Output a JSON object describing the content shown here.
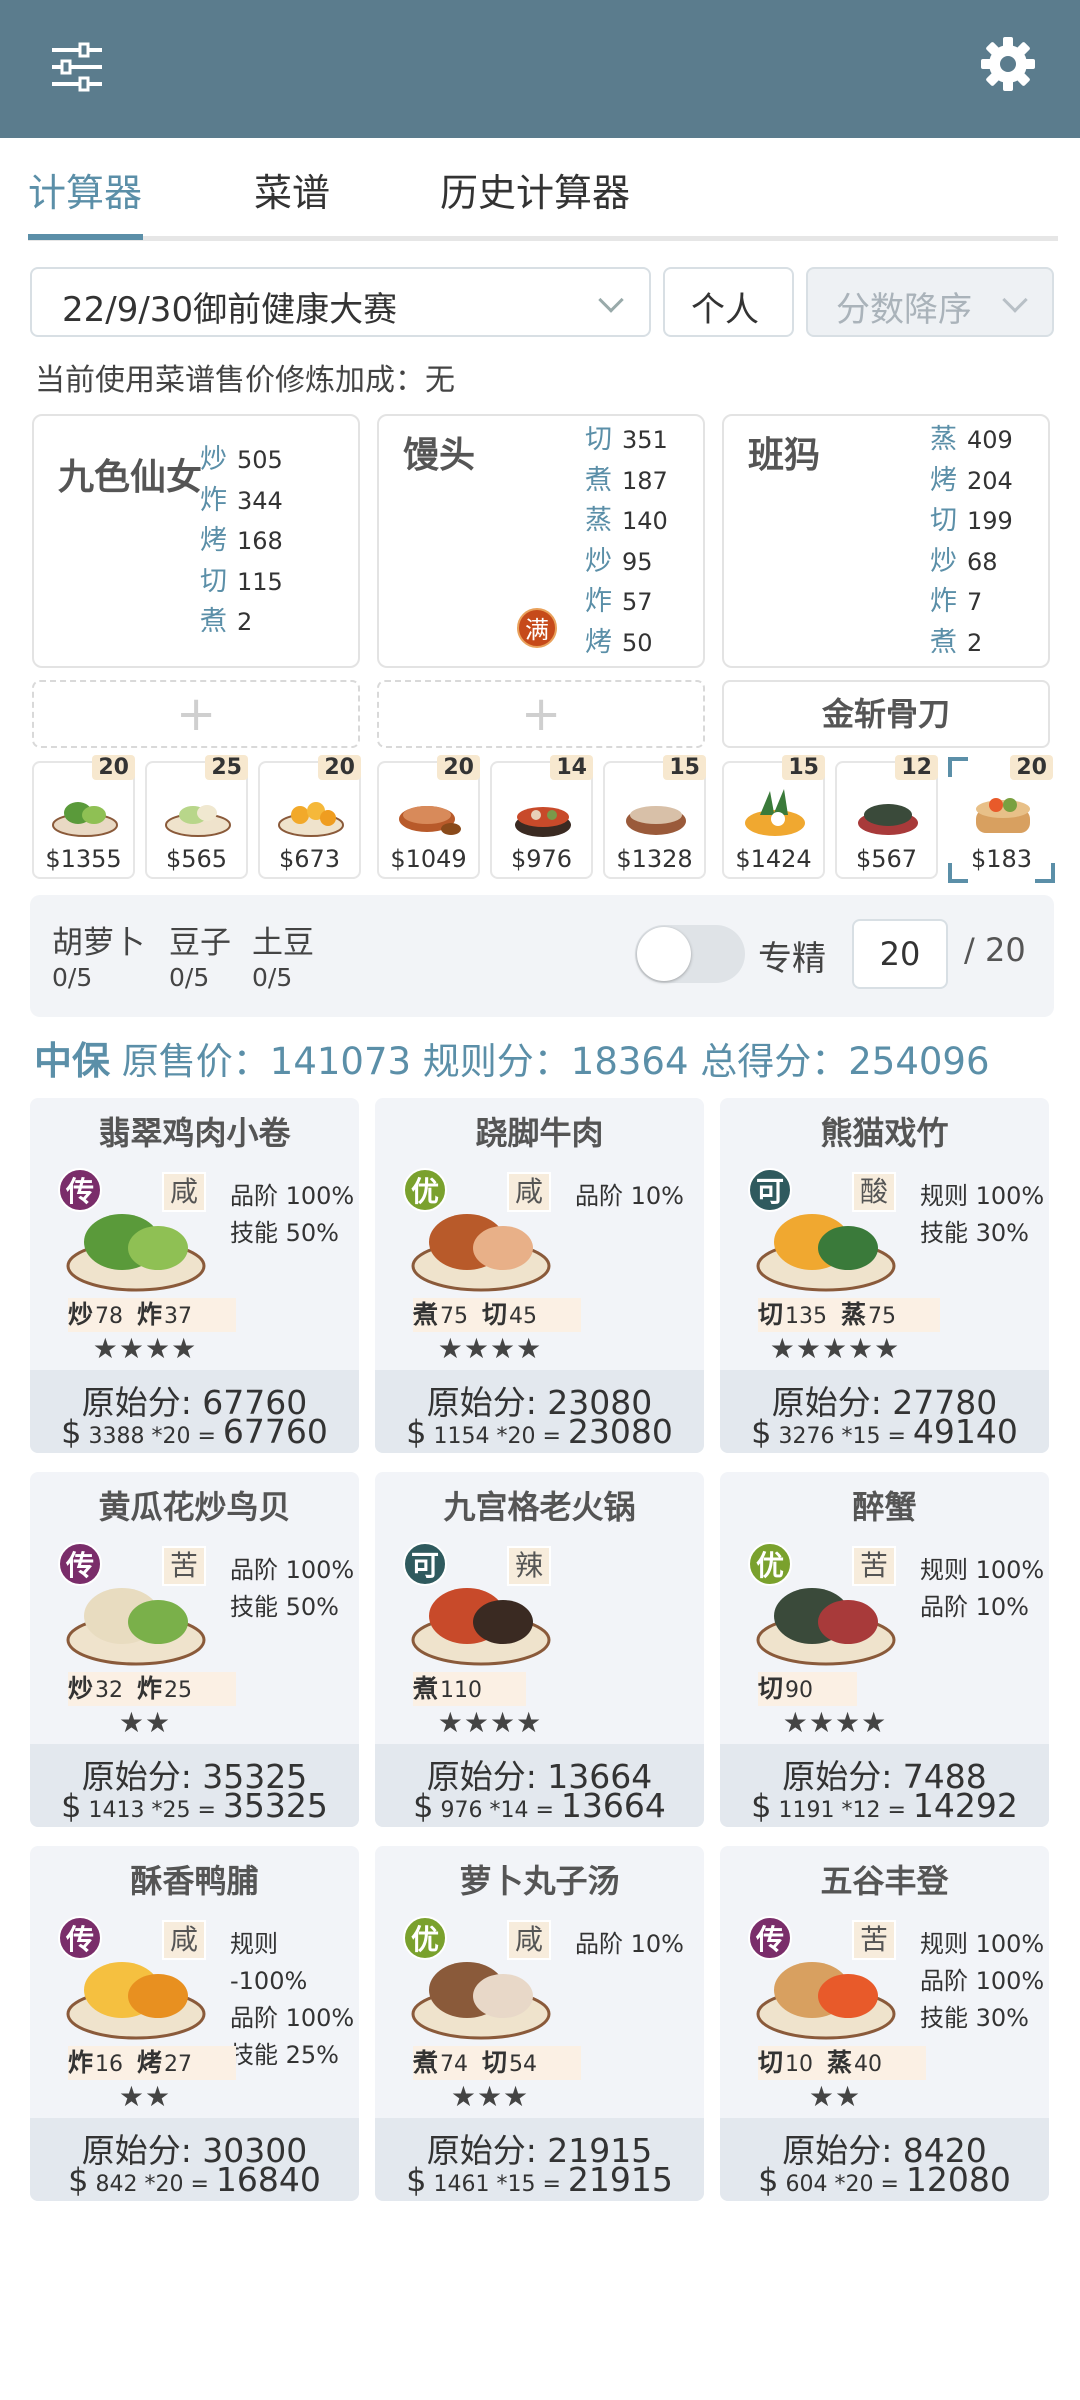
{
  "header": {
    "filter_icon": "sliders-icon",
    "settings_icon": "gear-icon"
  },
  "tabs": [
    {
      "label": "计算器"
    },
    {
      "label": "菜谱"
    },
    {
      "label": "历史计算器"
    }
  ],
  "controls": {
    "contest": "22/9/30御前健康大赛",
    "mode": "个人",
    "sort": "分数降序"
  },
  "note": "当前使用菜谱售价修炼加成：无",
  "chefs": [
    {
      "name": "九色仙女",
      "skills": [
        {
          "k": "炒",
          "v": "505"
        },
        {
          "k": "炸",
          "v": "344"
        },
        {
          "k": "烤",
          "v": "168"
        },
        {
          "k": "切",
          "v": "115"
        },
        {
          "k": "煮",
          "v": "2"
        }
      ]
    },
    {
      "name": "馒头",
      "badge": "满",
      "skills": [
        {
          "k": "切",
          "v": "351"
        },
        {
          "k": "煮",
          "v": "187"
        },
        {
          "k": "蒸",
          "v": "140"
        },
        {
          "k": "炒",
          "v": "95"
        },
        {
          "k": "炸",
          "v": "57"
        },
        {
          "k": "烤",
          "v": "50"
        }
      ]
    },
    {
      "name": "班犸",
      "skills": [
        {
          "k": "蒸",
          "v": "409"
        },
        {
          "k": "烤",
          "v": "204"
        },
        {
          "k": "切",
          "v": "199"
        },
        {
          "k": "炒",
          "v": "68"
        },
        {
          "k": "炸",
          "v": "7"
        },
        {
          "k": "煮",
          "v": "2"
        }
      ]
    }
  ],
  "equip": "金斩骨刀",
  "dishes": [
    {
      "count": "20",
      "price": "$1355"
    },
    {
      "count": "25",
      "price": "$565"
    },
    {
      "count": "20",
      "price": "$673"
    },
    {
      "count": "20",
      "price": "$1049"
    },
    {
      "count": "14",
      "price": "$976"
    },
    {
      "count": "15",
      "price": "$1328"
    },
    {
      "count": "15",
      "price": "$1424"
    },
    {
      "count": "12",
      "price": "$567"
    },
    {
      "count": "20",
      "price": "$183"
    }
  ],
  "ingredients": [
    {
      "name": "胡萝卜",
      "count": "0/5"
    },
    {
      "name": "豆子",
      "count": "0/5"
    },
    {
      "name": "土豆",
      "count": "0/5"
    }
  ],
  "specialize": {
    "label": "专精",
    "value": "20",
    "max": "/ 20",
    "on": false
  },
  "summary": {
    "grade": "中保",
    "text": "原售价：141073 规则分：18364 总得分：254096"
  },
  "recipes": [
    {
      "name": "翡翠鸡肉小卷",
      "grade": "传",
      "flavor": "咸",
      "bonus": [
        "品阶 100%",
        "技能 50%"
      ],
      "techs": [
        {
          "k": "炒",
          "v": "78"
        },
        {
          "k": "炸",
          "v": "37"
        }
      ],
      "stars": "★★★★",
      "raw": "原始分: 67760",
      "price": "3388",
      "mult": "*20",
      "total": "67760"
    },
    {
      "name": "跷脚牛肉",
      "grade": "优",
      "flavor": "咸",
      "bonus": [
        "品阶 10%"
      ],
      "techs": [
        {
          "k": "煮",
          "v": "75"
        },
        {
          "k": "切",
          "v": "45"
        }
      ],
      "stars": "★★★★",
      "raw": "原始分: 23080",
      "price": "1154",
      "mult": "*20",
      "total": "23080"
    },
    {
      "name": "熊猫戏竹",
      "grade": "可",
      "flavor": "酸",
      "bonus": [
        "规则 100%",
        "技能 30%"
      ],
      "techs": [
        {
          "k": "切",
          "v": "135"
        },
        {
          "k": "蒸",
          "v": "75"
        }
      ],
      "stars": "★★★★★",
      "raw": "原始分: 27780",
      "price": "3276",
      "mult": "*15",
      "total": "49140"
    },
    {
      "name": "黄瓜花炒鸟贝",
      "grade": "传",
      "flavor": "苦",
      "bonus": [
        "品阶 100%",
        "技能 50%"
      ],
      "techs": [
        {
          "k": "炒",
          "v": "32"
        },
        {
          "k": "炸",
          "v": "25"
        }
      ],
      "stars": "★★",
      "raw": "原始分: 35325",
      "price": "1413",
      "mult": "*25",
      "total": "35325"
    },
    {
      "name": "九宫格老火锅",
      "grade": "可",
      "flavor": "辣",
      "bonus": [],
      "techs": [
        {
          "k": "煮",
          "v": "110"
        }
      ],
      "stars": "★★★★",
      "raw": "原始分: 13664",
      "price": "976",
      "mult": "*14",
      "total": "13664"
    },
    {
      "name": "醉蟹",
      "grade": "优",
      "flavor": "苦",
      "bonus": [
        "规则 100%",
        "品阶 10%"
      ],
      "techs": [
        {
          "k": "切",
          "v": "90"
        }
      ],
      "stars": "★★★★",
      "raw": "原始分: 7488",
      "price": "1191",
      "mult": "*12",
      "total": "14292"
    },
    {
      "name": "酥香鸭脯",
      "grade": "传",
      "flavor": "咸",
      "bonus": [
        "规则 -100%",
        "品阶 100%",
        "技能 25%"
      ],
      "techs": [
        {
          "k": "炸",
          "v": "16"
        },
        {
          "k": "烤",
          "v": "27"
        }
      ],
      "stars": "★★",
      "raw": "原始分: 30300",
      "price": "842",
      "mult": "*20",
      "total": "16840"
    },
    {
      "name": "萝卜丸子汤",
      "grade": "优",
      "flavor": "咸",
      "bonus": [
        "品阶 10%"
      ],
      "techs": [
        {
          "k": "煮",
          "v": "74"
        },
        {
          "k": "切",
          "v": "54"
        }
      ],
      "stars": "★★★",
      "raw": "原始分: 21915",
      "price": "1461",
      "mult": "*15",
      "total": "21915"
    },
    {
      "name": "五谷丰登",
      "grade": "传",
      "flavor": "苦",
      "bonus": [
        "规则 100%",
        "品阶 100%",
        "技能 30%"
      ],
      "techs": [
        {
          "k": "切",
          "v": "10"
        },
        {
          "k": "蒸",
          "v": "40"
        }
      ],
      "stars": "★★",
      "raw": "原始分: 8420",
      "price": "604",
      "mult": "*20",
      "total": "12080"
    }
  ],
  "colors": {
    "header": "#5b7c8d",
    "accent": "#5b8fa8",
    "grade_chuan": "#7a2d6a",
    "grade_you": "#7aa12d",
    "grade_ke": "#2f5a5e"
  }
}
